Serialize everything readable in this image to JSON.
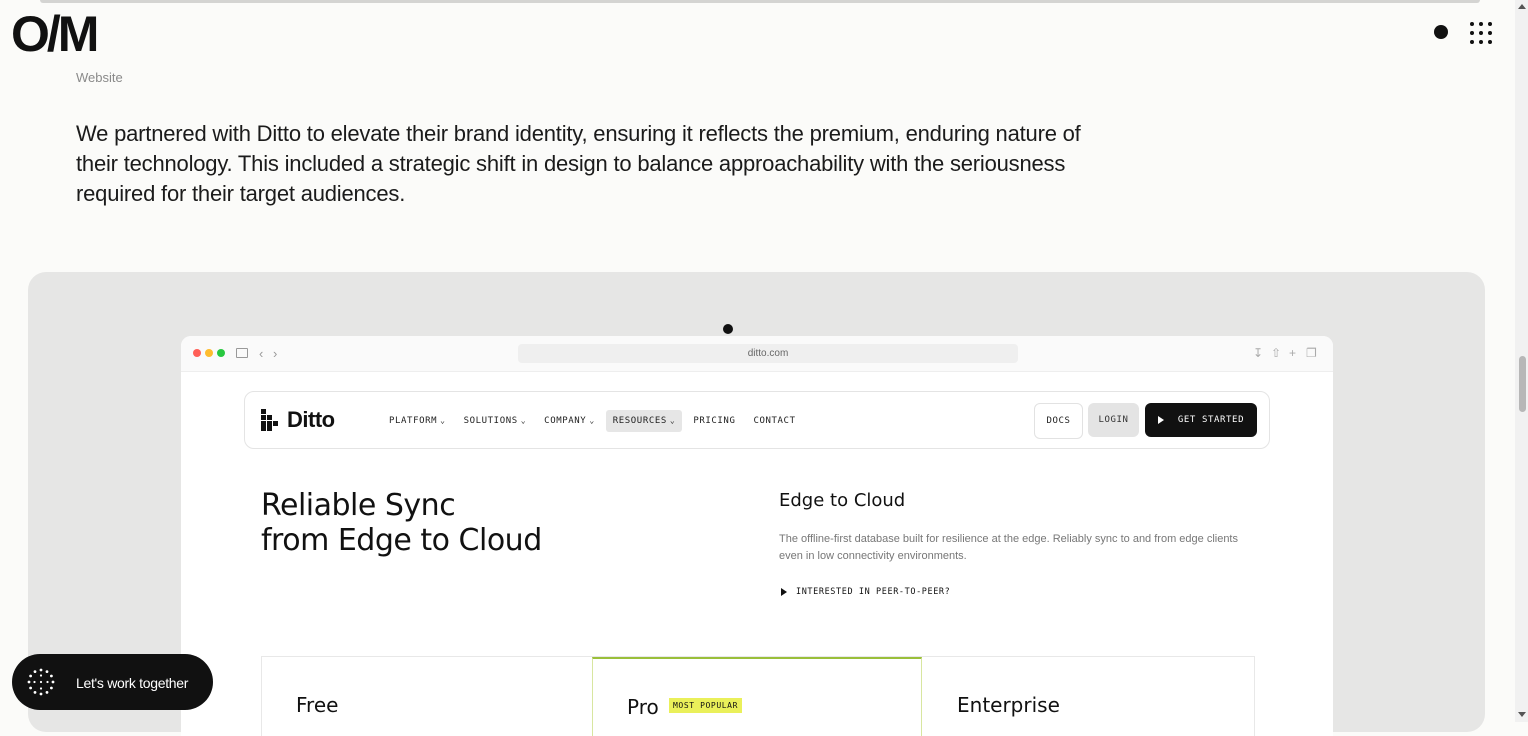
{
  "header": {
    "logo": "O/M"
  },
  "project": {
    "category": "Website",
    "intro": "We partnered with Ditto to elevate their brand identity, ensuring it reflects the premium, enduring nature of their technology. This included a strategic shift in design to balance approachability with the seriousness required for their target audiences."
  },
  "browser": {
    "url": "ditto.com"
  },
  "ditto": {
    "brand": "Ditto",
    "menu": [
      "PLATFORM",
      "SOLUTIONS",
      "COMPANY",
      "RESOURCES",
      "PRICING",
      "CONTACT"
    ],
    "docs": "DOCS",
    "login": "LOGIN",
    "get_started": "GET STARTED",
    "hero_title_line1": "Reliable Sync",
    "hero_title_line2": "from Edge to Cloud",
    "hero_subtitle": "Edge to Cloud",
    "hero_description": "The offline-first database built for resilience at the edge. Reliably sync to and from edge clients even in low connectivity environments.",
    "p2p_link": "INTERESTED IN PEER-TO-PEER?",
    "plans": {
      "free": "Free",
      "pro": "Pro",
      "pro_badge": "MOST POPULAR",
      "enterprise": "Enterprise"
    }
  },
  "cta": {
    "label": "Let's work together"
  },
  "colors": {
    "background": "#fbfbf9",
    "showcase": "#e6e6e5",
    "badge": "#eaf05a",
    "dark": "#111111"
  },
  "icons": [
    "grid-menu-icon",
    "download-icon",
    "share-icon",
    "plus-icon",
    "tabs-icon",
    "ditto-mark-icon",
    "play-icon",
    "dotted-circle-icon"
  ]
}
